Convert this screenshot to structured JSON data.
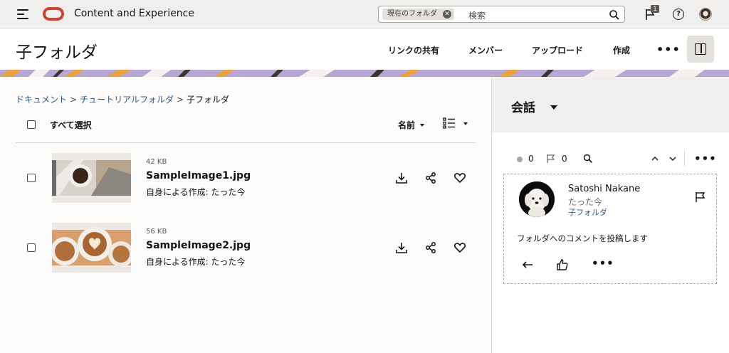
{
  "app": {
    "title": "Content and Experience"
  },
  "search": {
    "scope": "現在のフォルダ",
    "placeholder": "検索"
  },
  "notifications": {
    "count": "1"
  },
  "header": {
    "title": "子フォルダ",
    "share_link": "リンクの共有",
    "members": "メンバー",
    "upload": "アップロード",
    "create": "作成"
  },
  "breadcrumb": {
    "root": "ドキュメント",
    "parent": "チュートリアルフォルダ",
    "current": "子フォルダ"
  },
  "list": {
    "select_all": "すべて選択",
    "sort": "名前",
    "files": [
      {
        "size": "42 KB",
        "name": "SampleImage1.jpg",
        "meta": "自身による作成: たった今"
      },
      {
        "size": "56 KB",
        "name": "SampleImage2.jpg",
        "meta": "自身による作成: たった今"
      }
    ]
  },
  "sidebar": {
    "title": "会話",
    "unread_count": "0",
    "flag_count": "0",
    "comment": {
      "author": "Satoshi Nakane",
      "time": "たった今",
      "folder": "子フォルダ",
      "text": "フォルダへのコメントを投稿します"
    }
  },
  "colors": {
    "accent": "#c74634",
    "link": "#2d5a87",
    "banner": "#b7a6d3"
  }
}
